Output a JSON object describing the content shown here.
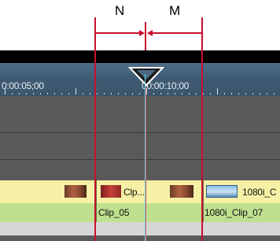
{
  "annotations": {
    "left_label": "N",
    "right_label": "M"
  },
  "ruler": {
    "timecode_left": "0:00:05;00",
    "timecode_center": "00:00:10;00"
  },
  "tracks": {
    "video_clips": [
      {
        "label": "Clp..."
      },
      {
        "label": "1080i_C"
      }
    ],
    "audio_clips": [
      {
        "label": "Clip_05"
      },
      {
        "label": "1080i_Clip_07"
      }
    ]
  },
  "colors": {
    "annotation_red": "#c8102e",
    "playhead_cyan": "#5fd7e6",
    "clip_yellow": "#f5f0a5",
    "clip_green": "#bfe08f"
  }
}
